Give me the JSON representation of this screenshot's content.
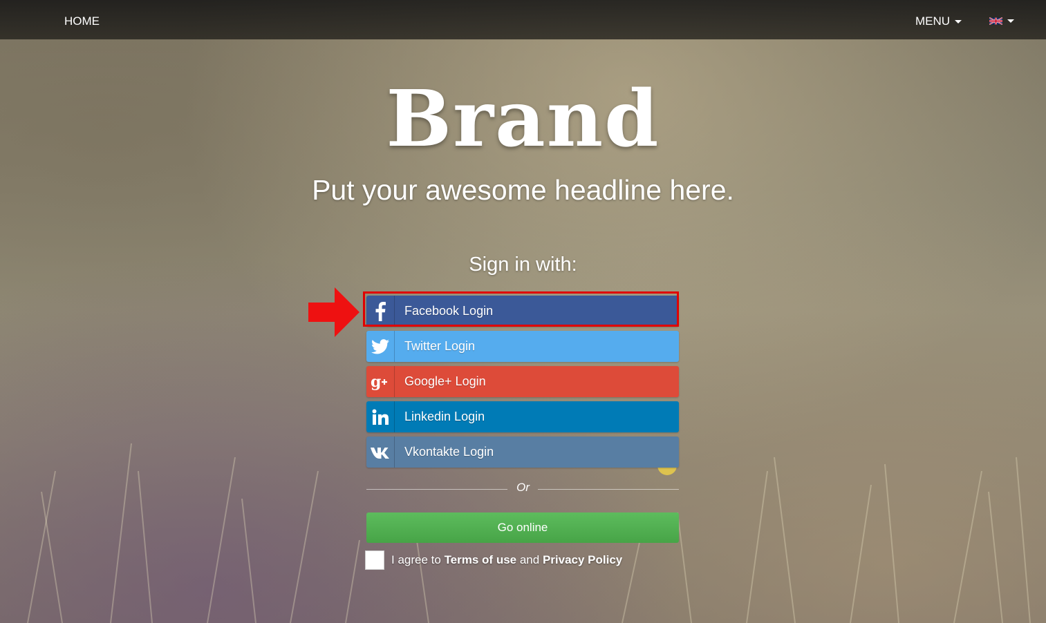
{
  "nav": {
    "home_label": "HOME",
    "menu_label": "MENU",
    "language_flag": "uk-flag-icon"
  },
  "hero": {
    "brand": "Brand",
    "headline": "Put your awesome headline here."
  },
  "signin": {
    "title": "Sign in with:",
    "buttons": [
      {
        "label": "Facebook Login",
        "icon": "facebook-icon",
        "color": "#3b5998"
      },
      {
        "label": "Twitter Login",
        "icon": "twitter-icon",
        "color": "#55acee"
      },
      {
        "label": "Google+ Login",
        "icon": "google-plus-icon",
        "color": "#dd4b39"
      },
      {
        "label": "Linkedin Login",
        "icon": "linkedin-icon",
        "color": "#007bb6"
      },
      {
        "label": "Vkontakte Login",
        "icon": "vk-icon",
        "color": "#587ea3"
      }
    ],
    "or_label": "Or",
    "go_online_label": "Go online",
    "go_online_color": "#5cb85c",
    "agree": {
      "prefix": "I agree to ",
      "terms": "Terms of use",
      "middle": " and ",
      "privacy": "Privacy Policy"
    }
  },
  "annotation": {
    "highlight_color": "#e00000"
  }
}
